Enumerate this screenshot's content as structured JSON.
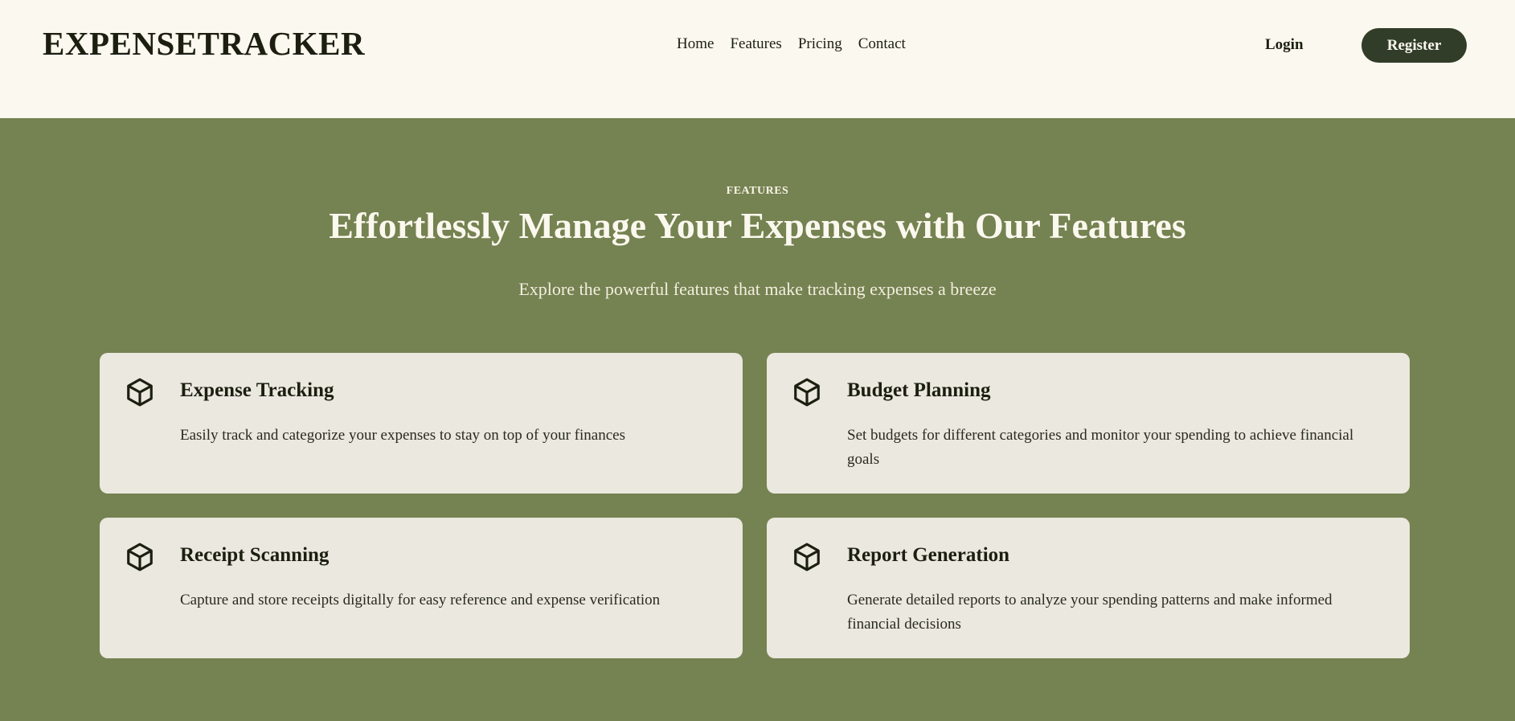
{
  "header": {
    "logo": "EXPENSETRACKER",
    "nav": [
      "Home",
      "Features",
      "Pricing",
      "Contact"
    ],
    "login_label": "Login",
    "register_label": "Register"
  },
  "hero": {
    "eyebrow": "FEATURES",
    "headline": "Effortlessly Manage Your Expenses with Our Features",
    "subhead": "Explore the powerful features that make tracking expenses a breeze"
  },
  "features": [
    {
      "icon": "box-icon",
      "title": "Expense Tracking",
      "description": "Easily track and categorize your expenses to stay on top of your finances"
    },
    {
      "icon": "box-icon",
      "title": "Budget Planning",
      "description": "Set budgets for different categories and monitor your spending to achieve financial goals"
    },
    {
      "icon": "box-icon",
      "title": "Receipt Scanning",
      "description": "Capture and store receipts digitally for easy reference and expense verification"
    },
    {
      "icon": "box-icon",
      "title": "Report Generation",
      "description": "Generate detailed reports to analyze your spending patterns and make informed financial decisions"
    }
  ],
  "colors": {
    "header_bg": "#fbf8ef",
    "hero_bg": "#758251",
    "card_bg": "#eae8df",
    "button_bg": "#323d29",
    "text_dark": "#1c1f10"
  }
}
